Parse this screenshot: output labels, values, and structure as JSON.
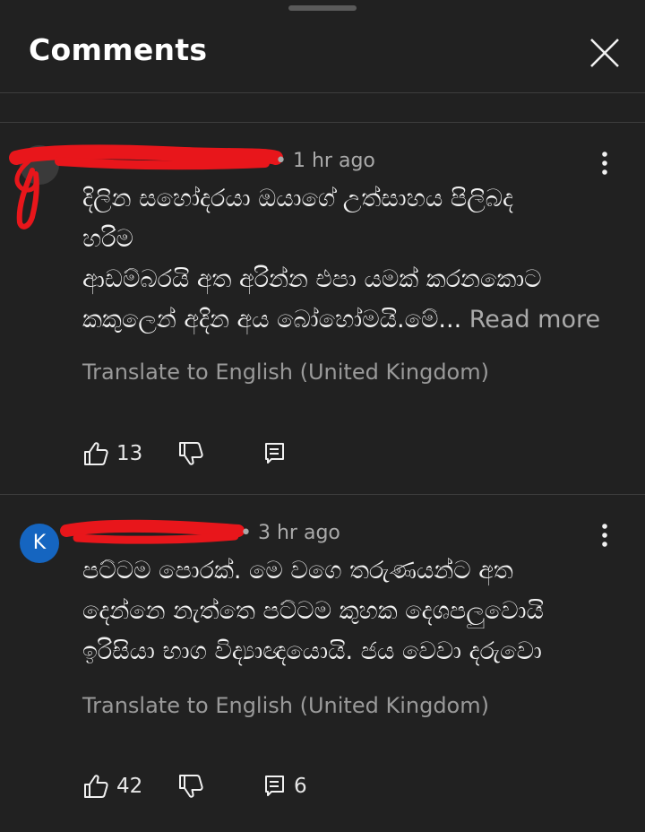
{
  "header": {
    "title": "Comments"
  },
  "comments": [
    {
      "time": "1 hr ago",
      "body_lines": [
        "දිලින සහෝදරයා ඔයාගේ උත්සාහය පිලිබද",
        "හරිම",
        "ආඩම්බරයි අත අරින්න එපා යමක් කරනකොට",
        "කකුලෙන් අදින අය බෝහෝමයි.මේ..."
      ],
      "read_more": "Read more",
      "translate": "Translate to English (United Kingdom)",
      "likes": "13",
      "replies": ""
    },
    {
      "avatar_letter": "K",
      "avatar_color": "#1565c0",
      "time": "3 hr ago",
      "body_lines": [
        "පට්ටම පොරක්. මෙ වගෙ තරුණයන්ට අත",
        "දෙන්නෙ නැත්තෙ පට්ටම කුහක දෙශපලුවොයි",
        "ඉරිසියා භාග විද්‍යාඥයොයි. ජය වෙවා දරුවො"
      ],
      "translate": "Translate to English (United Kingdom)",
      "likes": "42",
      "replies": "6"
    }
  ],
  "icons": {
    "close": "close-icon",
    "more": "more-vert-icon",
    "like": "thumb-up-icon",
    "dislike": "thumb-down-icon",
    "reply": "reply-icon"
  },
  "colors": {
    "redaction": "#e8161b",
    "background": "#212121"
  }
}
